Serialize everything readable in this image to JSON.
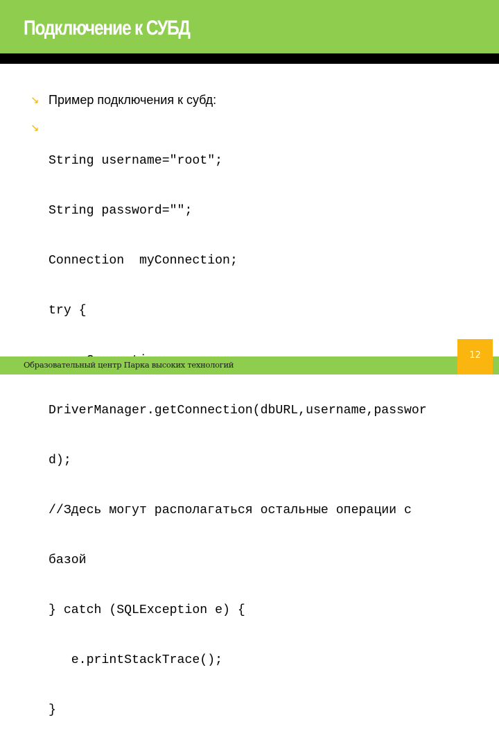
{
  "slide": {
    "title": "Подключение к СУБД",
    "colors": {
      "title_bar": "#8fcd4e",
      "title_rule": "#000000",
      "bullet": "#f0b400",
      "footer_band": "#8fcd4e",
      "page_badge": "#fbb50f"
    }
  },
  "bullets": {
    "icon": "arrow-down-right-icon",
    "intro": "Пример подключения к субд:",
    "code_lines": [
      "String username=\"root\";",
      "String password=\"\";",
      "Connection  myConnection;",
      "try {",
      "   myConnection =",
      "DriverManager.getConnection(dbURL,username,passwor",
      "d);",
      "//Здесь могут располагаться остальные операции с",
      "базой",
      "} catch (SQLException e) {",
      "   e.printStackTrace();",
      "}"
    ]
  },
  "footer": {
    "organization": "Образовательный центр Парка высоких технологий",
    "page_number": "12"
  }
}
